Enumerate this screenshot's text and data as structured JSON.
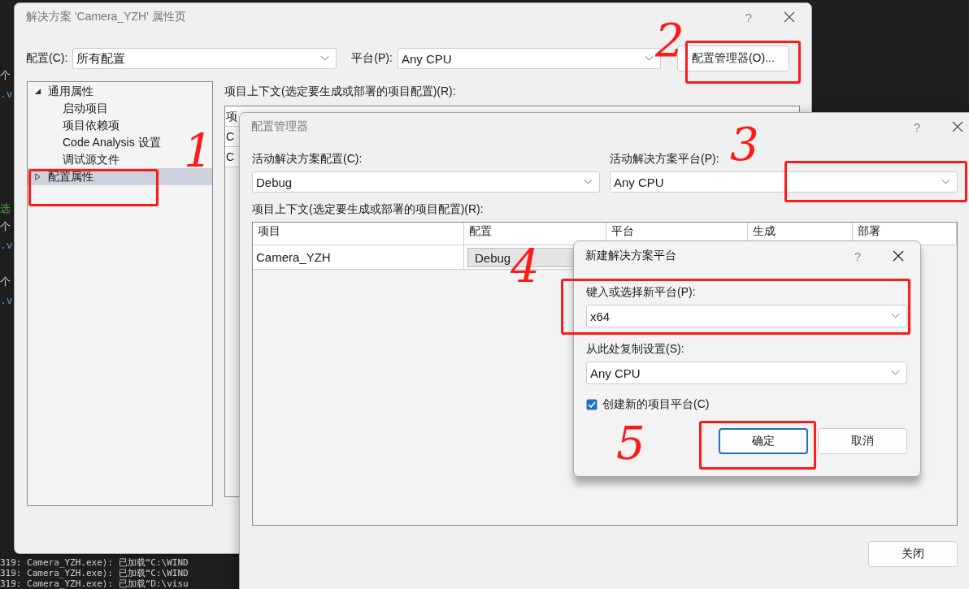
{
  "background": {
    "editor_lines": [
      {
        "text": "个",
        "kind": "plain"
      },
      {
        "text": ".v",
        "kind": "code"
      },
      {
        "text": "选",
        "kind": "comment"
      },
      {
        "text": "个",
        "kind": "plain"
      },
      {
        "text": ".v",
        "kind": "code"
      },
      {
        "text": "个",
        "kind": "plain"
      },
      {
        "text": ".v",
        "kind": "code"
      }
    ],
    "output_lines": [
      "319: Camera_YZH.exe): 已加载“C:\\WIND",
      "319: Camera_YZH.exe): 已加载“C:\\WIND",
      "319: Camera_YZH.exe): 已加载“D:\\visu"
    ]
  },
  "property_window": {
    "title": "解决方案 'Camera_YZH' 属性页",
    "help": "?",
    "config_label": "配置(C):",
    "config_value": "所有配置",
    "platform_label": "平台(P):",
    "platform_value": "Any CPU",
    "manager_button": "配置管理器(O)...",
    "tree": [
      {
        "label": "通用属性",
        "expanded": true,
        "selected": false,
        "children": [
          {
            "label": "启动项目",
            "selected": false
          },
          {
            "label": "项目依赖项",
            "selected": false
          },
          {
            "label": "Code Analysis 设置",
            "selected": false
          },
          {
            "label": "调试源文件",
            "selected": false
          }
        ]
      },
      {
        "label": "配置属性",
        "expanded": false,
        "selected": true
      }
    ],
    "context_label": "项目上下文(选定要生成或部署的项目配置)(R):",
    "table_header": "项",
    "table_rows": [
      "C",
      "C"
    ]
  },
  "config_manager": {
    "title": "配置管理器",
    "help": "?",
    "active_config_label": "活动解决方案配置(C):",
    "active_config_value": "Debug",
    "active_platform_label": "活动解决方案平台(P):",
    "active_platform_value": "Any CPU",
    "context_label": "项目上下文(选定要生成或部署的项目配置)(R):",
    "columns": [
      "项目",
      "配置",
      "平台",
      "生成",
      "部署"
    ],
    "rows": [
      {
        "project": "Camera_YZH",
        "config": "Debug"
      }
    ],
    "close_button": "关闭"
  },
  "new_platform_dialog": {
    "title": "新建解决方案平台",
    "help": "?",
    "new_platform_label": "键入或选择新平台(P):",
    "new_platform_value": "x64",
    "copy_label": "从此处复制设置(S):",
    "copy_value": "Any CPU",
    "create_projects_label": "创建新的项目平台(C)",
    "create_projects_checked": true,
    "ok_button": "确定",
    "cancel_button": "取消"
  },
  "annotations": [
    {
      "text": "1"
    },
    {
      "text": "2"
    },
    {
      "text": "3"
    },
    {
      "text": "4"
    },
    {
      "text": "5"
    }
  ]
}
